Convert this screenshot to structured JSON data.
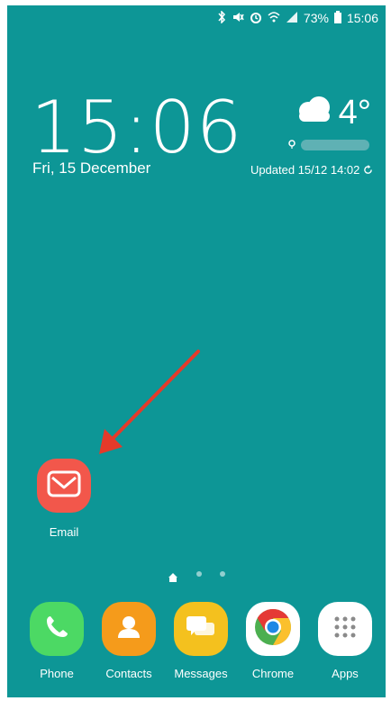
{
  "status_bar": {
    "battery": "73%",
    "time": "15:06",
    "icons": [
      "bluetooth-icon",
      "mute-icon",
      "alarm-icon",
      "wifi-icon",
      "signal-icon",
      "battery-icon"
    ]
  },
  "widget": {
    "time": "15:06",
    "date": "Fri, 15 December",
    "temperature": "4°",
    "weather_icon": "cloud-icon",
    "updated": "Updated 15/12  14:02"
  },
  "home_apps": [
    {
      "label": "Email",
      "color": "#f2574b",
      "icon": "email-icon"
    }
  ],
  "page_indicator": {
    "pages": 3,
    "current": 1
  },
  "dock_apps": [
    {
      "label": "Phone",
      "color": "#4cd964",
      "icon": "phone-icon"
    },
    {
      "label": "Contacts",
      "color": "#f59b1b",
      "icon": "contacts-icon"
    },
    {
      "label": "Messages",
      "color": "#f4c11e",
      "icon": "messages-icon"
    },
    {
      "label": "Chrome",
      "color": "#ffffff",
      "icon": "chrome-icon"
    },
    {
      "label": "Apps",
      "color": "#ffffff",
      "icon": "apps-grid-icon"
    }
  ],
  "colors": {
    "wallpaper": "#0d9696",
    "annotation_arrow": "#e53a2a"
  }
}
